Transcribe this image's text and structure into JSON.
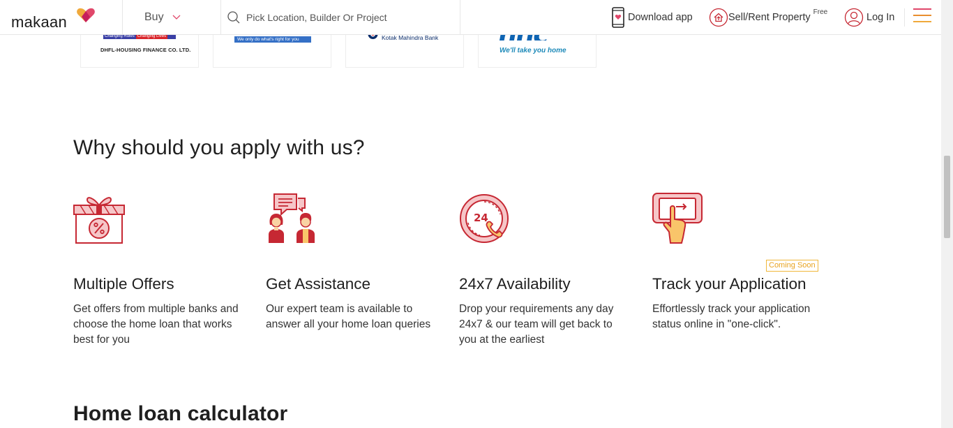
{
  "header": {
    "logo_text": "makaan",
    "buy_label": "Buy",
    "search_placeholder": "Pick Location, Builder Or Project",
    "download_label": "Download app",
    "sell_label": "Sell/Rent Property",
    "free_badge": "Free",
    "login_label": "Log In"
  },
  "banks": {
    "dhfl_strip_left": "Changing Rules",
    "dhfl_strip_right": "Changing Lives",
    "dhfl_name": "DHFL-HOUSING FINANCE CO. LTD.",
    "bank2_tagline": "We only do what's right for you",
    "bank3_name": "Kotak Mahindra Bank",
    "bank4_logo": "nnc",
    "bank4_tagline": "We'll take you home"
  },
  "why": {
    "title": "Why should you apply with us?",
    "features": [
      {
        "icon": "gift-percent-icon",
        "title": "Multiple Offers",
        "desc": "Get offers from multiple banks and choose the home loan that works best for you"
      },
      {
        "icon": "assistance-chat-icon",
        "title": "Get Assistance",
        "desc": "Our expert team is available to answer all your home loan queries"
      },
      {
        "icon": "24x7-phone-icon",
        "title": "24x7 Availability",
        "desc": "Drop your requirements any day 24x7 & our team will get back to you at the earliest"
      },
      {
        "icon": "tap-track-icon",
        "title": "Track your Application",
        "desc": "Effortlessly track your application status online in \"one-click\".",
        "badge": "Coming Soon"
      }
    ]
  },
  "calculator": {
    "title": "Home loan calculator"
  },
  "colors": {
    "brand_pink": "#e0476a",
    "brand_orange": "#f0a93b",
    "icon_red": "#c62833",
    "icon_fill": "#f6c6c8"
  }
}
